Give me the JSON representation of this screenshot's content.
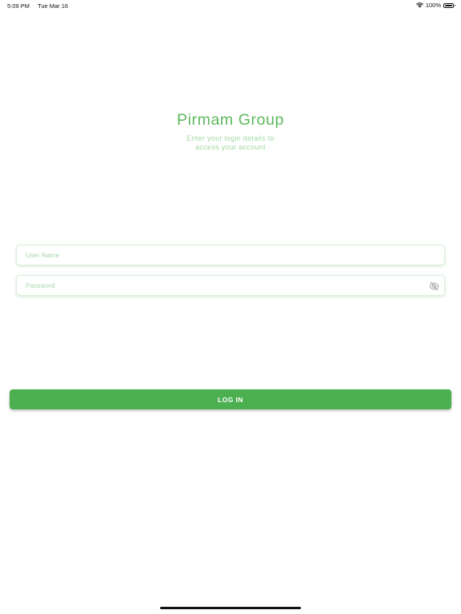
{
  "status_bar": {
    "time": "5:09 PM",
    "date": "Tue Mar 16",
    "battery": "100%",
    "icons": [
      "wifi-icon",
      "battery-icon"
    ]
  },
  "header": {
    "title": "Pirmam Group",
    "subtitle_line1": "Enter your login details to",
    "subtitle_line2": "access your account"
  },
  "form": {
    "username_placeholder": "User Name",
    "username_value": "",
    "password_placeholder": "Password",
    "password_value": "",
    "password_toggle_icon": "eye-off-icon",
    "login_label": "LOG IN"
  },
  "colors": {
    "accent": "#4caf50",
    "title": "#5cb85c",
    "subtitle": "#a4d8a4",
    "placeholder": "#a8d5a8",
    "background": "#ffffff"
  }
}
